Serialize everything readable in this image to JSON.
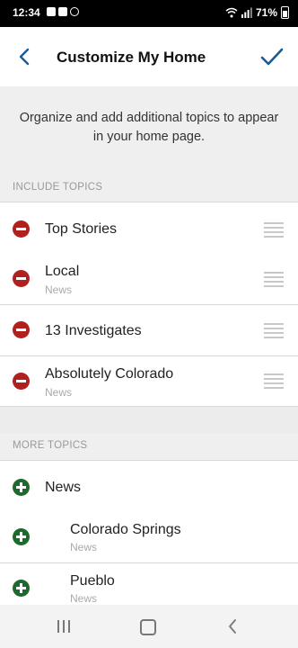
{
  "status_bar": {
    "time": "12:34",
    "battery": "71%"
  },
  "header": {
    "title": "Customize My Home",
    "back_icon": "chevron-left-icon",
    "done_icon": "checkmark-icon",
    "accent_color": "#1a5b96"
  },
  "intro": {
    "text": "Organize and add additional topics to appear in your home page."
  },
  "include_topics": {
    "label": "INCLUDE TOPICS",
    "items": [
      {
        "label": "Top Stories",
        "subtitle": ""
      },
      {
        "label": "Local",
        "subtitle": "News"
      },
      {
        "label": "13 Investigates",
        "subtitle": ""
      },
      {
        "label": "Absolutely Colorado",
        "subtitle": "News"
      }
    ]
  },
  "more_topics": {
    "label": "MORE TOPICS",
    "items": [
      {
        "label": "News",
        "subtitle": ""
      },
      {
        "label": "Colorado Springs",
        "subtitle": "News"
      },
      {
        "label": "Pueblo",
        "subtitle": "News"
      }
    ]
  },
  "colors": {
    "remove": "#b0201f",
    "add": "#1d6b2c"
  }
}
